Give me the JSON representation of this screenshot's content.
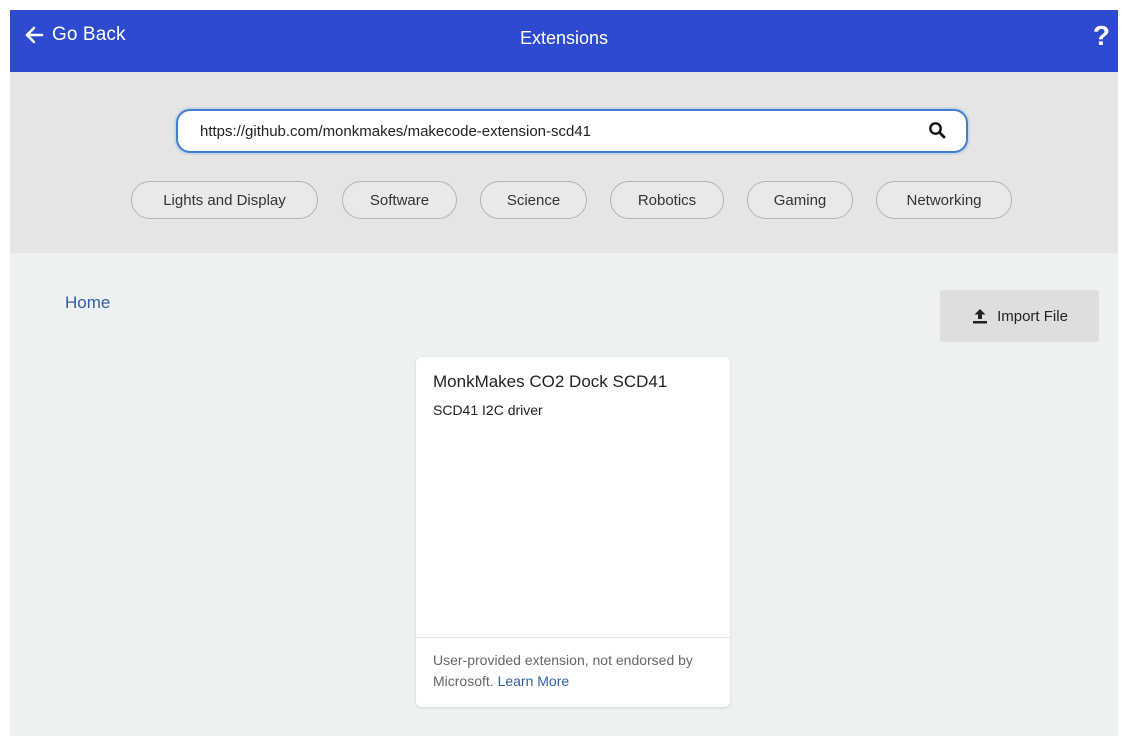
{
  "header": {
    "back_label": "Go Back",
    "title": "Extensions",
    "help_label": "?",
    "color": "#2d4ad0"
  },
  "search": {
    "value": "https://github.com/monkmakes/makecode-extension-scd41",
    "icon": "search-icon"
  },
  "categories": [
    {
      "label": "Lights and Display"
    },
    {
      "label": "Software"
    },
    {
      "label": "Science"
    },
    {
      "label": "Robotics"
    },
    {
      "label": "Gaming"
    },
    {
      "label": "Networking"
    }
  ],
  "breadcrumb": {
    "home_label": "Home"
  },
  "import": {
    "label": "Import File",
    "icon": "upload-icon"
  },
  "results": [
    {
      "title": "MonkMakes CO2 Dock SCD41",
      "description": "SCD41 I2C driver",
      "footer_text": "User-provided extension, not endorsed by Microsoft.",
      "learn_more_label": "Learn More"
    }
  ]
}
